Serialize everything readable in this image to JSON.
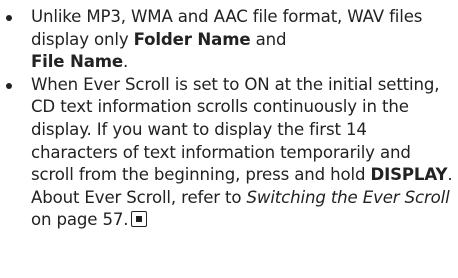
{
  "bullets": [
    {
      "t1": "Unlike MP3, WMA and AAC file format, WAV files display only ",
      "b1": "Folder Name",
      "t2": " and ",
      "b2": "File Name",
      "t3": "."
    },
    {
      "t1": "When Ever Scroll is set to ON at the initial setting, CD text information scrolls continuously in the display. If you want to display the first 14 characters of text information temporarily and scroll from the beginning, press and hold ",
      "b1": "DISPLAY",
      "t2": ". About Ever Scroll, refer to ",
      "i1": "Switching the Ever Scroll",
      "t3": " on page 57."
    }
  ],
  "end_marker_icon": "end-of-section-icon"
}
